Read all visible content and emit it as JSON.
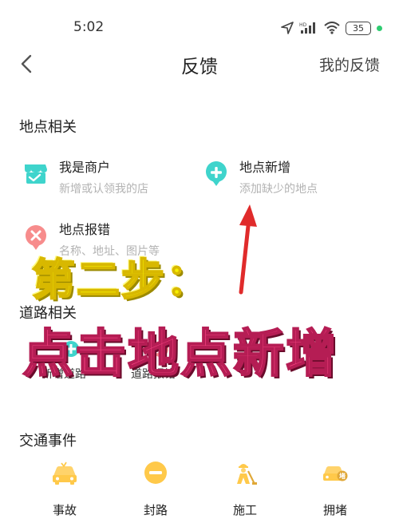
{
  "status_bar": {
    "time": "5:02",
    "battery": "35"
  },
  "header": {
    "title": "反馈",
    "right_link": "我的反馈"
  },
  "location_section": {
    "title": "地点相关",
    "items": [
      {
        "title": "我是商户",
        "subtitle": "新增或认领我的店",
        "icon": "store-icon"
      },
      {
        "title": "地点新增",
        "subtitle": "添加缺少的地点",
        "icon": "plus-location-icon"
      },
      {
        "title": "地点报错",
        "subtitle": "名称、地址、图片等",
        "icon": "error-location-icon"
      }
    ]
  },
  "road_section": {
    "title": "道路相关",
    "items": [
      {
        "label": "新增道路"
      },
      {
        "label": "道路报错"
      }
    ]
  },
  "traffic_section": {
    "title": "交通事件",
    "items": [
      {
        "label": "事故",
        "icon": "car-accident-icon"
      },
      {
        "label": "封路",
        "icon": "road-closed-icon"
      },
      {
        "label": "施工",
        "icon": "construction-worker-icon"
      },
      {
        "label": "拥堵",
        "icon": "traffic-jam-icon"
      }
    ]
  },
  "overlay": {
    "step": "第二步：",
    "instruction": "点击地点新增"
  },
  "colors": {
    "teal_icon": "#3fd4cc",
    "red_icon": "#f46b6b",
    "yellow_icon": "#ffc94a",
    "arrow": "#e02b2b",
    "step_text": "#f6f000",
    "instruction_text": "#ef3e7c"
  }
}
